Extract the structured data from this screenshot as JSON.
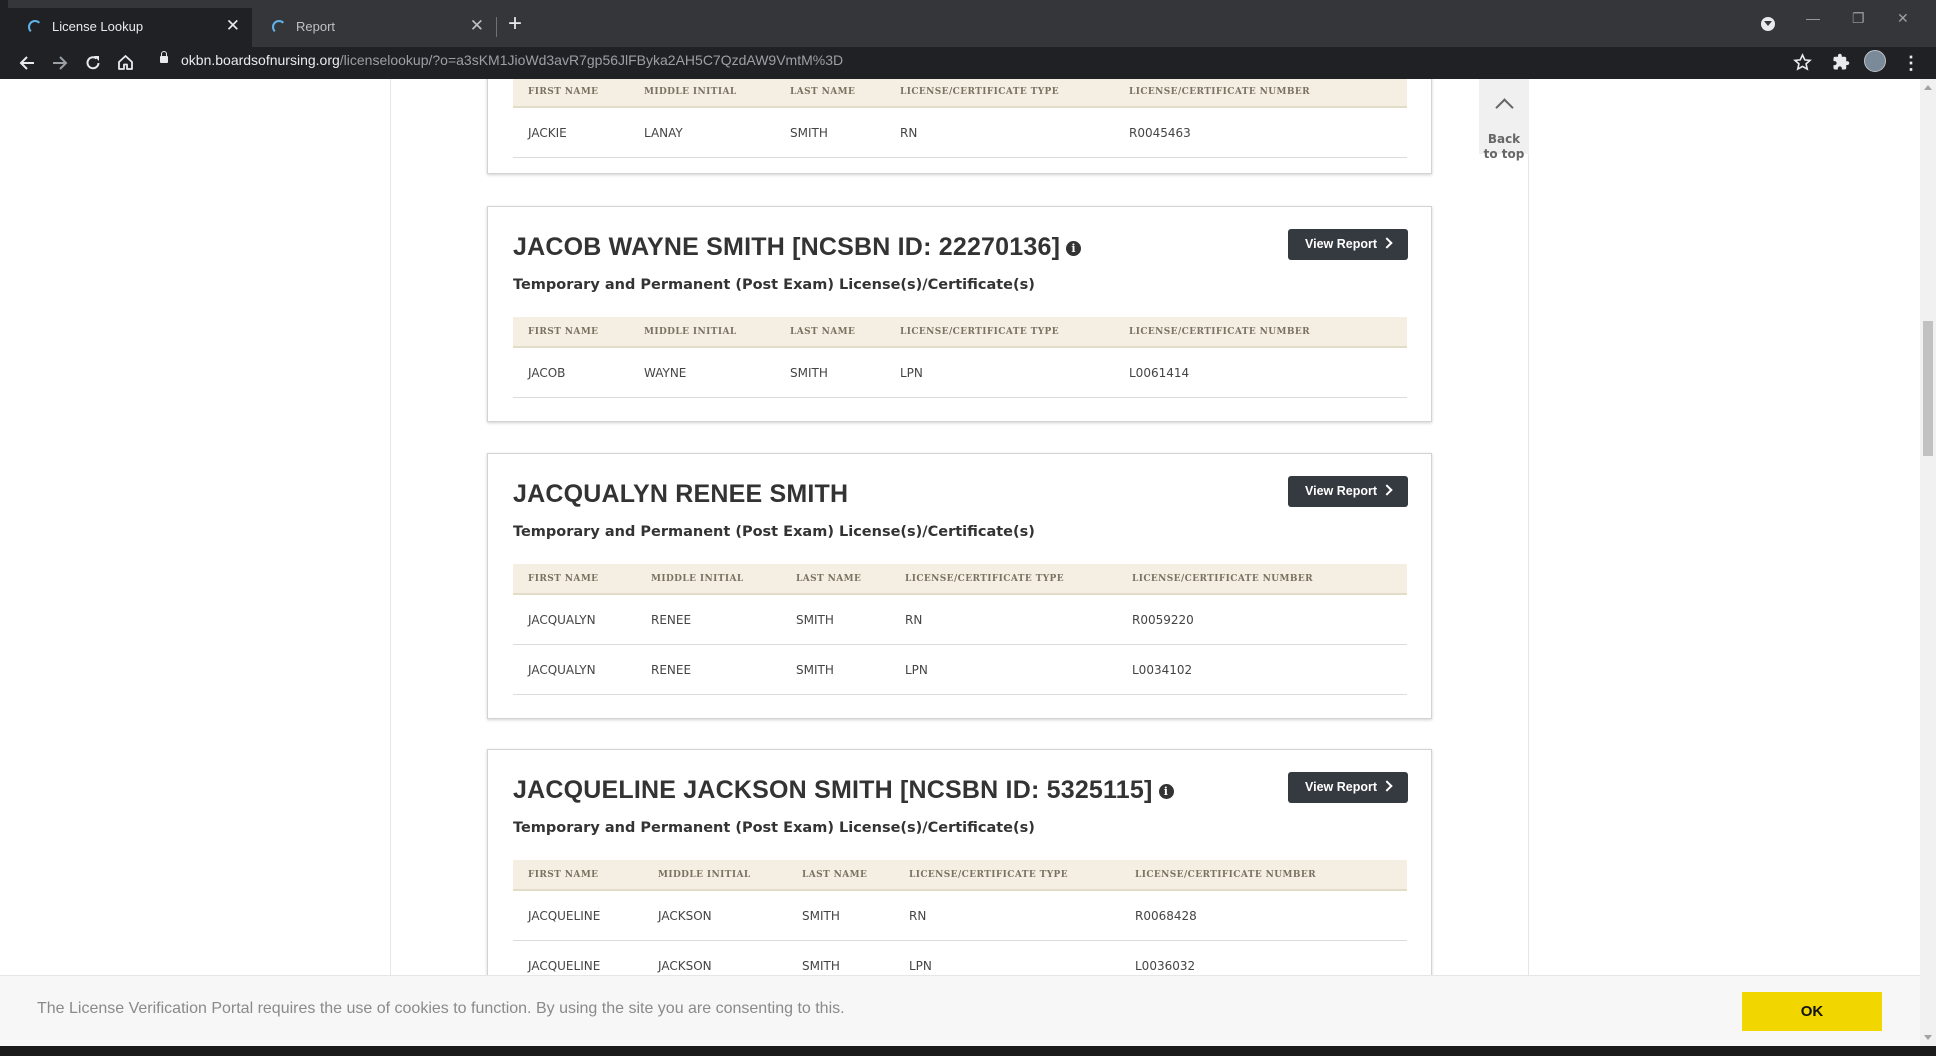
{
  "browser": {
    "tabs": [
      {
        "title": "License Lookup",
        "active": true
      },
      {
        "title": "Report",
        "active": false
      }
    ],
    "close_glyph": "✕",
    "new_tab_glyph": "+",
    "url_host": "okbn.boardsofnursing.org",
    "url_path": "/licenselookup/?o=a3sKM1JioWd3avR7gp56JlFByka2AH5C7QzdAW9VmtM%3D",
    "icons": [
      "back-icon",
      "forward-icon",
      "reload-icon",
      "home-icon",
      "lock-icon",
      "star-icon",
      "extensions-icon",
      "profile-avatar",
      "menu-icon"
    ]
  },
  "back_to_top": {
    "label": "Back to top"
  },
  "columns": [
    "FIRST NAME",
    "MIDDLE INITIAL",
    "LAST NAME",
    "LICENSE/CERTIFICATE TYPE",
    "LICENSE/CERTIFICATE NUMBER"
  ],
  "records": [
    {
      "name": "",
      "subtitle": "",
      "rows": [
        {
          "first": "JACKIE",
          "middle": "LANAY",
          "last": "SMITH",
          "type": "RN",
          "number": "R0045463"
        }
      ]
    },
    {
      "name": "JACOB WAYNE SMITH [NCSBN ID: 22270136]",
      "has_info": true,
      "subtitle": "Temporary and Permanent (Post Exam) License(s)/Certificate(s)",
      "button": "View Report",
      "rows": [
        {
          "first": "JACOB",
          "middle": "WAYNE",
          "last": "SMITH",
          "type": "LPN",
          "number": "L0061414"
        }
      ]
    },
    {
      "name": "JACQUALYN RENEE SMITH",
      "has_info": false,
      "subtitle": "Temporary and Permanent (Post Exam) License(s)/Certificate(s)",
      "button": "View Report",
      "rows": [
        {
          "first": "JACQUALYN",
          "middle": "RENEE",
          "last": "SMITH",
          "type": "RN",
          "number": "R0059220"
        },
        {
          "first": "JACQUALYN",
          "middle": "RENEE",
          "last": "SMITH",
          "type": "LPN",
          "number": "L0034102"
        }
      ]
    },
    {
      "name": "JACQUELINE JACKSON SMITH [NCSBN ID: 5325115]",
      "has_info": true,
      "subtitle": "Temporary and Permanent (Post Exam) License(s)/Certificate(s)",
      "button": "View Report",
      "rows": [
        {
          "first": "JACQUELINE",
          "middle": "JACKSON",
          "last": "SMITH",
          "type": "RN",
          "number": "R0068428"
        },
        {
          "first": "JACQUELINE",
          "middle": "JACKSON",
          "last": "SMITH",
          "type": "LPN",
          "number": "L0036032"
        }
      ]
    }
  ],
  "cookie": {
    "message": "The License Verification Portal requires the use of cookies to function. By using the site you are consenting to this.",
    "ok_label": "OK"
  },
  "colors": {
    "button": "#343a40",
    "table_header": "#f4efe2",
    "cookie_ok": "#f2d600",
    "chrome": "#202124"
  }
}
